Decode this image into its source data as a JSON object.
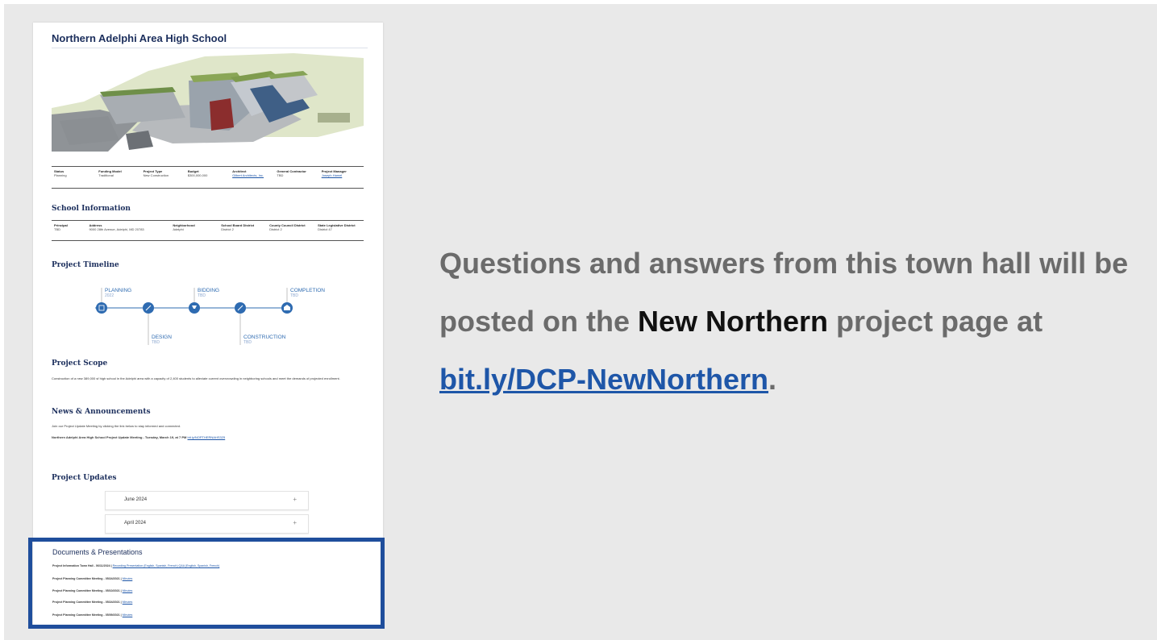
{
  "school_page": {
    "title": "Northern Adelphi Area High School",
    "project_table": [
      {
        "label": "Status",
        "value": "Planning",
        "is_link": false
      },
      {
        "label": "Funding Model",
        "value": "Traditional",
        "is_link": false
      },
      {
        "label": "Project Type",
        "value": "New Construction",
        "is_link": false
      },
      {
        "label": "Budget",
        "value": "$300,000,000",
        "is_link": false
      },
      {
        "label": "Architect",
        "value": "Gilbert Architects, Inc.",
        "is_link": true
      },
      {
        "label": "General Contractor",
        "value": "TBD",
        "is_link": false
      },
      {
        "label": "Project Manager",
        "value": "Joseph Hamel",
        "is_link": true
      }
    ],
    "school_info_heading": "School Information",
    "school_info_table": [
      {
        "label": "Principal",
        "value": "TBD",
        "is_link": false
      },
      {
        "label": "Address",
        "value": "9000 28th Avenue, Adelphi, MD 20783",
        "is_link": false
      },
      {
        "label": "Neighborhood",
        "value": "Adelphi",
        "is_link": false
      },
      {
        "label": "School Board District",
        "value": "District 2",
        "is_link": false
      },
      {
        "label": "County Council District",
        "value": "District 2",
        "is_link": false
      },
      {
        "label": "State Legislative District",
        "value": "District 47",
        "is_link": false
      }
    ],
    "timeline_heading": "Project Timeline",
    "timeline": [
      {
        "phase": "PLANNING",
        "date": "2022",
        "icon": "building-icon"
      },
      {
        "phase": "DESIGN",
        "date": "TBD",
        "icon": "pencil-icon"
      },
      {
        "phase": "BIDDING",
        "date": "TBD",
        "icon": "gavel-icon"
      },
      {
        "phase": "CONSTRUCTION",
        "date": "TBD",
        "icon": "wrench-icon"
      },
      {
        "phase": "COMPLETION",
        "date": "TBD",
        "icon": "school-icon"
      }
    ],
    "scope_heading": "Project Scope",
    "scope_text": "Construction of a new 389,000 sf high school in the Adelphi area with a capacity of 2,400 students to alleviate current overcrowding in neighboring schools and meet the demands of projected enrollment.",
    "news_heading": "News & Announcements",
    "news_line1": "Join our Project Update Meeting by clicking the link below to stay informed and connected.",
    "news_line2": "Northern Adelphi Area High School Project Update Meeting - Tuesday, March 19, at 7 PM",
    "news_link": "bit.ly/NOPTHERNAHS325",
    "updates_heading": "Project Updates",
    "updates": [
      {
        "label": "June 2024",
        "icon": "+"
      },
      {
        "label": "April 2024",
        "icon": "+"
      }
    ],
    "docs_heading": "Documents & Presentations",
    "docs": [
      {
        "text": "Project Information Town Hall - 06/11/2024 |",
        "links": "Recording Presentation (English, Spanish, French) Q&A (English, Spanish, French)"
      },
      {
        "text": "Project Planning Committee Meeting - 05/24/2021 |",
        "links": "Minutes"
      },
      {
        "text": "Project Planning Committee Meeting - 05/10/2021 |",
        "links": "Minutes"
      },
      {
        "text": "Project Planning Committee Meeting - 05/24/2021 |",
        "links": "Minutes"
      },
      {
        "text": "Project Planning Committee Meeting - 05/09/2021 |",
        "links": "Minutes"
      }
    ]
  },
  "message": {
    "part1": "Questions and answers from this town hall will be posted on the ",
    "bold": "New Northern",
    "part2": " project page at ",
    "url": "bit.ly/DCP-NewNorthern",
    "end": "."
  },
  "colors": {
    "slide_bg": "#e9e9e9",
    "navy": "#1b2e5c",
    "timeline_blue": "#2e6bb1",
    "highlight_box": "#1f4e9c",
    "link": "#1e56a8",
    "message_gray": "#6b6b6b"
  }
}
